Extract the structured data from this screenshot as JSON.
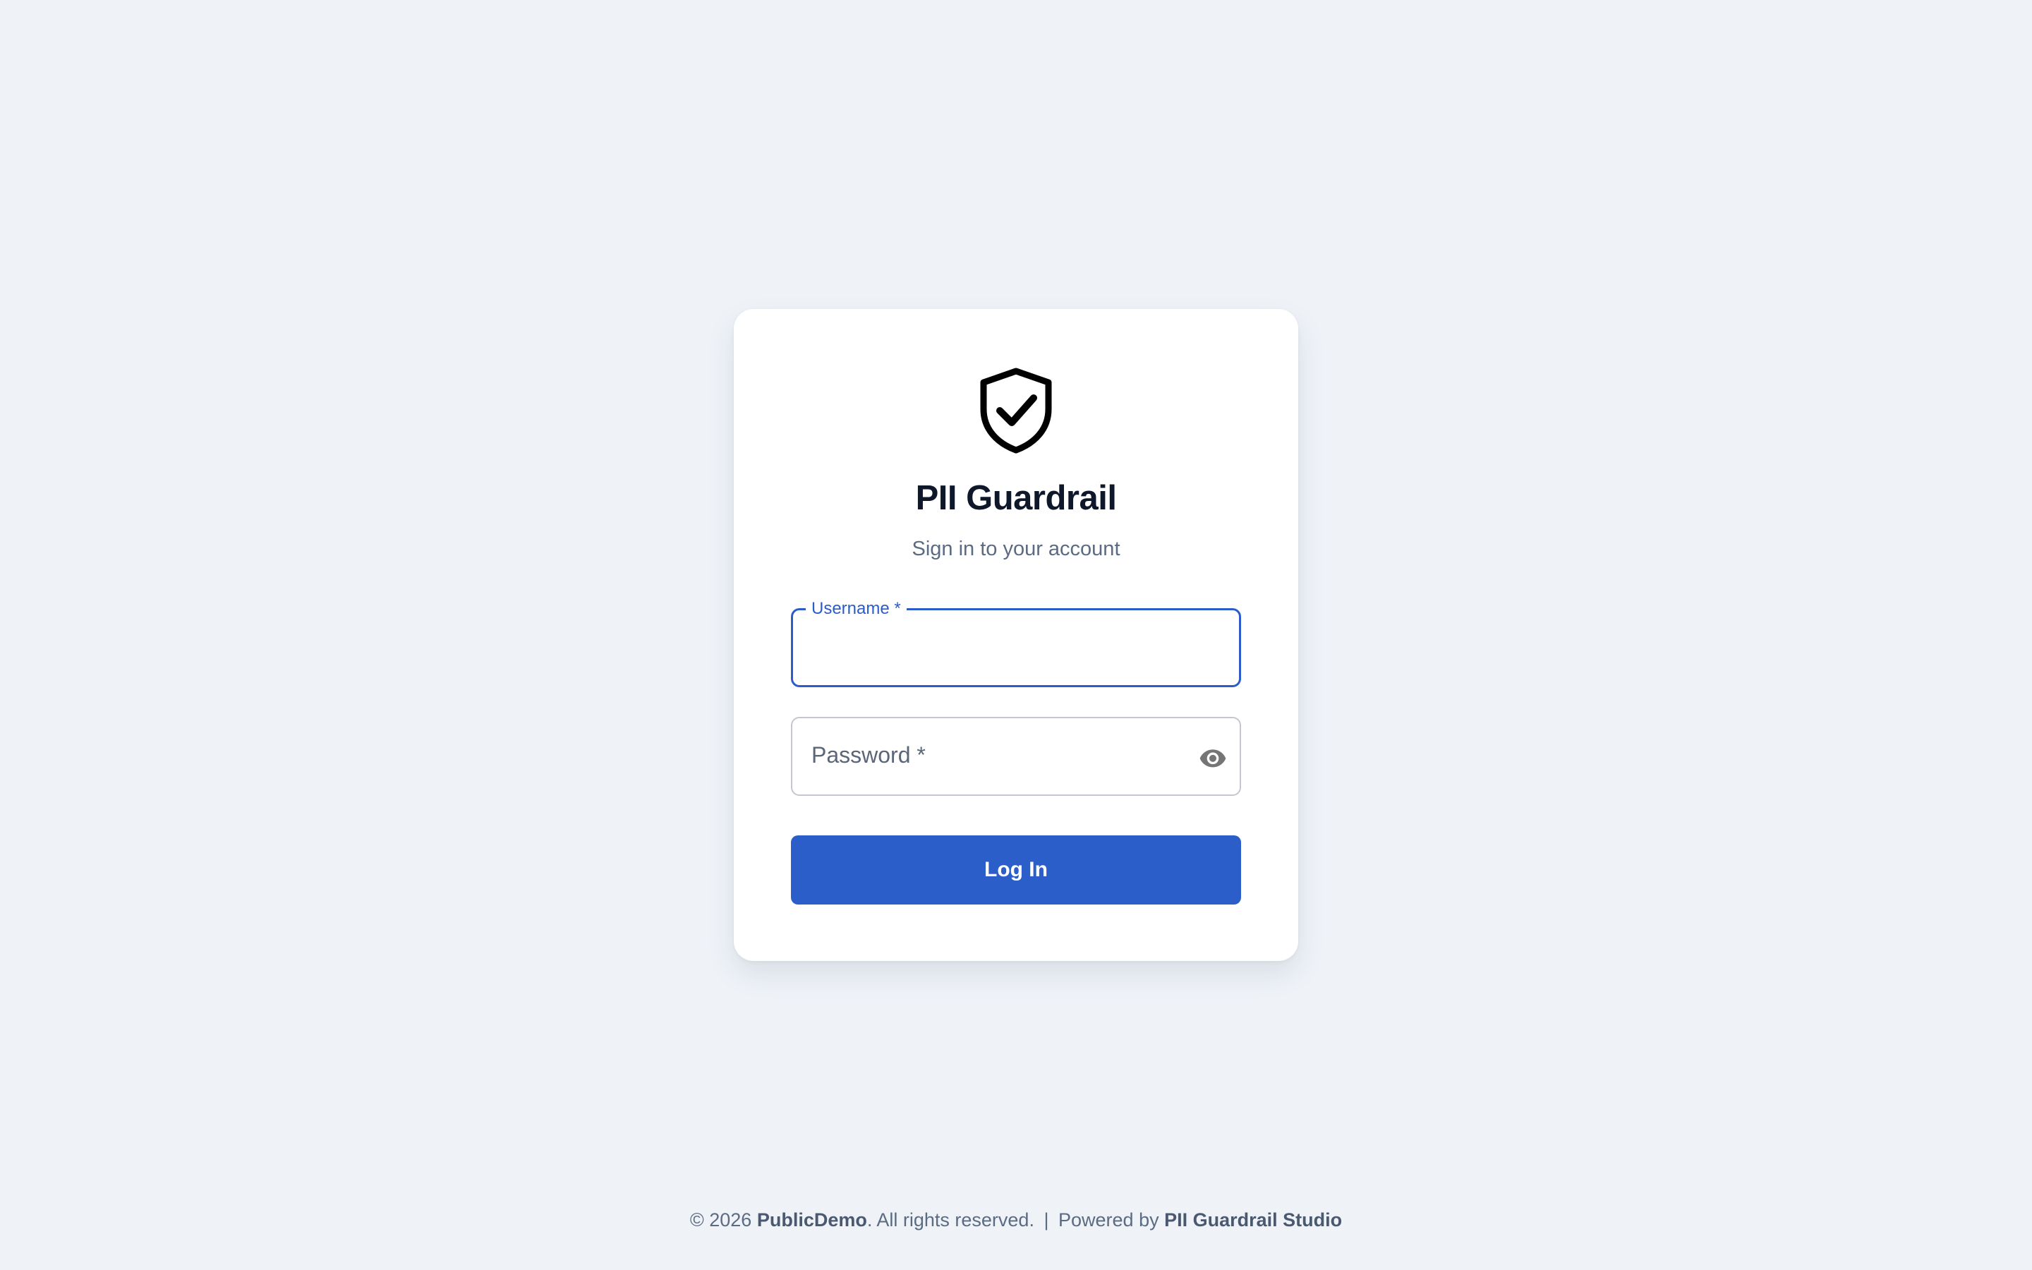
{
  "app": {
    "title": "PII Guardrail",
    "subtitle": "Sign in to your account",
    "logo_icon": "shield-check-icon"
  },
  "form": {
    "username": {
      "label": "Username *",
      "value": ""
    },
    "password": {
      "label": "Password *",
      "value": "",
      "toggle_icon": "eye-icon"
    },
    "submit_label": "Log In"
  },
  "footer": {
    "copyright": "© 2026",
    "owner": "PublicDemo",
    "rights": ". All rights reserved.",
    "separator": "|",
    "powered_prefix": "Powered by",
    "powered_name": "PII Guardrail Studio"
  },
  "colors": {
    "background": "#eff3f8",
    "card": "#ffffff",
    "accent": "#2c5ec9",
    "title": "#0f172a",
    "muted": "#5b6b82"
  }
}
